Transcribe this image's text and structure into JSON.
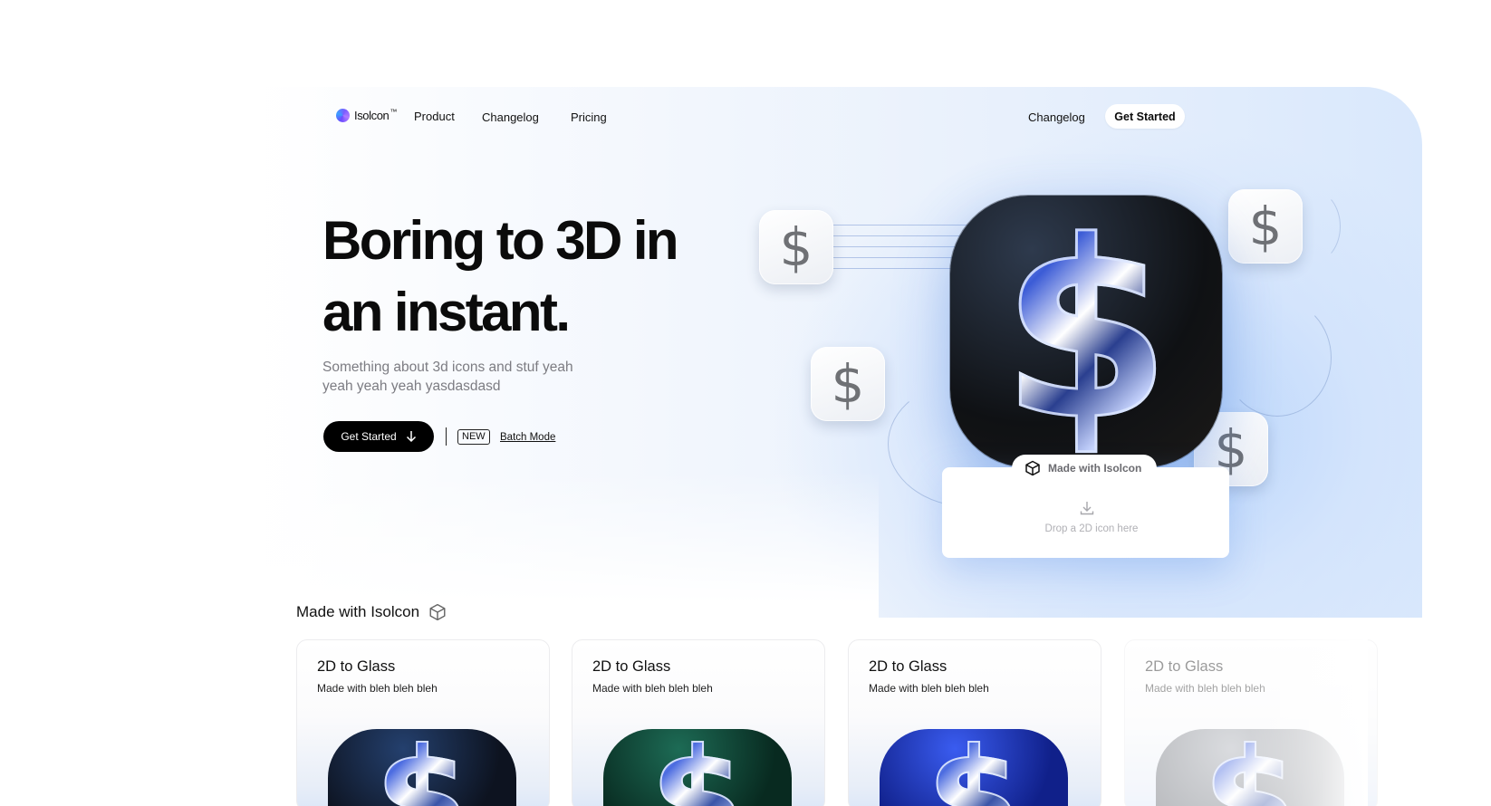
{
  "nav": {
    "brand": "Isolcon",
    "brand_suffix": "™",
    "links": [
      "Product",
      "Changelog",
      "Pricing"
    ],
    "right_link": "Changelog",
    "cta": "Get Started"
  },
  "hero": {
    "headline_line1": "Boring to 3D in",
    "headline_line2": "an instant.",
    "subtext_line1": "Something about 3d icons and stuf yeah",
    "subtext_line2": "yeah yeah yeah yasdasdasd",
    "primary_button": "Get Started",
    "badge": "NEW",
    "badge_link": "Batch Mode"
  },
  "showcase": {
    "icon_glyph": "$",
    "pill_label": "Made with Isolcon",
    "drop_hint": "Drop a 2D icon here"
  },
  "gallery": {
    "title": "Made with Isolcon",
    "cards": [
      {
        "title": "2D to Glass",
        "subtitle": "Made with bleh bleh bleh",
        "color": "#0f1a2e"
      },
      {
        "title": "2D to Glass",
        "subtitle": "Made with bleh bleh bleh",
        "color": "#0d3a2c"
      },
      {
        "title": "2D to Glass",
        "subtitle": "Made with bleh bleh bleh",
        "color": "#1a2fa0"
      },
      {
        "title": "2D to Glass",
        "subtitle": "Made with bleh bleh bleh",
        "color": "#8a8e96"
      }
    ]
  },
  "colors": {
    "accent": "#000000",
    "hero_tint": "#d9e8fc"
  },
  "icons": [
    "isolcon-logo-icon",
    "arrow-down-icon",
    "cube-icon",
    "download-icon",
    "dollar-icon"
  ]
}
